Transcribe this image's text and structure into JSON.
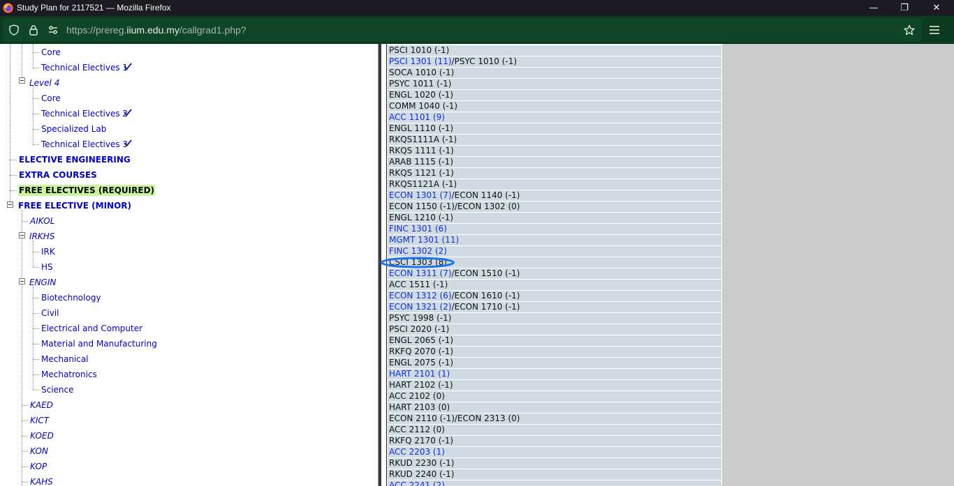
{
  "window": {
    "title": "Study Plan for 2117521 — Mozilla Firefox",
    "controls": [
      "—",
      "❐",
      "✕"
    ]
  },
  "toolbar": {
    "url_prefix": "https://prereg.",
    "url_host": "iium.edu.my",
    "url_path": "/callgrad1.php?"
  },
  "tree": [
    {
      "label": "Core",
      "style": "normal"
    },
    {
      "label": "Technical Electives 1",
      "style": "normal",
      "check": true
    },
    {
      "label": "Level 4",
      "style": "italic"
    },
    {
      "label": "Core",
      "style": "normal"
    },
    {
      "label": "Technical Electives 2",
      "style": "normal",
      "check": true
    },
    {
      "label": "Specialized Lab",
      "style": "normal"
    },
    {
      "label": "Technical Electives 3",
      "style": "normal",
      "check": true
    },
    {
      "label": "ELECTIVE ENGINEERING",
      "style": "bold"
    },
    {
      "label": "EXTRA COURSES",
      "style": "bold"
    },
    {
      "label": "FREE ELECTIVES (REQUIRED)",
      "style": "bold-highlight"
    },
    {
      "label": "FREE ELECTIVE (MINOR)",
      "style": "bold"
    },
    {
      "label": "AIKOL",
      "style": "italic"
    },
    {
      "label": "IRKHS",
      "style": "italic"
    },
    {
      "label": "IRK",
      "style": "normal"
    },
    {
      "label": "HS",
      "style": "normal"
    },
    {
      "label": "ENGIN",
      "style": "italic"
    },
    {
      "label": "Biotechnology",
      "style": "normal"
    },
    {
      "label": "Civil",
      "style": "normal"
    },
    {
      "label": "Electrical and Computer",
      "style": "normal"
    },
    {
      "label": "Material and Manufacturing",
      "style": "normal"
    },
    {
      "label": "Mechanical",
      "style": "normal"
    },
    {
      "label": "Mechatronics",
      "style": "normal"
    },
    {
      "label": "Science",
      "style": "normal"
    },
    {
      "label": "KAED",
      "style": "italic"
    },
    {
      "label": "KICT",
      "style": "italic"
    },
    {
      "label": "KOED",
      "style": "italic"
    },
    {
      "label": "KON",
      "style": "italic"
    },
    {
      "label": "KOP",
      "style": "italic"
    },
    {
      "label": "KAHS",
      "style": "italic"
    }
  ],
  "courses": [
    [
      {
        "t": "PSCI 1010 (-1)",
        "link": false
      }
    ],
    [
      {
        "t": "PSCI 1301 (11)",
        "link": true
      },
      {
        "t": "/PSYC 1010 (-1)",
        "link": false
      }
    ],
    [
      {
        "t": "SOCA 1010 (-1)",
        "link": false
      }
    ],
    [
      {
        "t": "PSYC 1011 (-1)",
        "link": false
      }
    ],
    [
      {
        "t": "ENGL 1020 (-1)",
        "link": false
      }
    ],
    [
      {
        "t": "COMM 1040 (-1)",
        "link": false
      }
    ],
    [
      {
        "t": "ACC 1101 (9)",
        "link": true
      }
    ],
    [
      {
        "t": "ENGL 1110 (-1)",
        "link": false
      }
    ],
    [
      {
        "t": "RKQS1111A (-1)",
        "link": false
      }
    ],
    [
      {
        "t": "RKQS 1111 (-1)",
        "link": false
      }
    ],
    [
      {
        "t": "ARAB 1115 (-1)",
        "link": false
      }
    ],
    [
      {
        "t": "RKQS 1121 (-1)",
        "link": false
      }
    ],
    [
      {
        "t": "RKQS1121A (-1)",
        "link": false
      }
    ],
    [
      {
        "t": "ECON 1301 (7)",
        "link": true
      },
      {
        "t": "/ECON 1140 (-1)",
        "link": false
      }
    ],
    [
      {
        "t": "ECON 1150 (-1)/ECON 1302 (0)",
        "link": false
      }
    ],
    [
      {
        "t": "ENGL 1210 (-1)",
        "link": false
      }
    ],
    [
      {
        "t": "FINC 1301 (6)",
        "link": true
      }
    ],
    [
      {
        "t": "MGMT 1301 (11)",
        "link": true
      }
    ],
    [
      {
        "t": "FINC 1302 (2)",
        "link": true
      }
    ],
    [
      {
        "t": "CSCI 1303 (8)",
        "link": false
      }
    ],
    [
      {
        "t": "ECON 1311 (7)",
        "link": true
      },
      {
        "t": "/ECON 1510 (-1)",
        "link": false
      }
    ],
    [
      {
        "t": "ACC 1511 (-1)",
        "link": false
      }
    ],
    [
      {
        "t": "ECON 1312 (6)",
        "link": true
      },
      {
        "t": "/ECON 1610 (-1)",
        "link": false
      }
    ],
    [
      {
        "t": "ECON 1321 (2)",
        "link": true
      },
      {
        "t": "/ECON 1710 (-1)",
        "link": false
      }
    ],
    [
      {
        "t": "PSYC 1998 (-1)",
        "link": false
      }
    ],
    [
      {
        "t": "PSCI 2020 (-1)",
        "link": false
      }
    ],
    [
      {
        "t": "ENGL 2065 (-1)",
        "link": false
      }
    ],
    [
      {
        "t": "RKFQ 2070 (-1)",
        "link": false
      }
    ],
    [
      {
        "t": "ENGL 2075 (-1)",
        "link": false
      }
    ],
    [
      {
        "t": "HART 2101 (1)",
        "link": true
      }
    ],
    [
      {
        "t": "HART 2102 (-1)",
        "link": false
      }
    ],
    [
      {
        "t": "ACC 2102 (0)",
        "link": false
      }
    ],
    [
      {
        "t": "HART 2103 (0)",
        "link": false
      }
    ],
    [
      {
        "t": "ECON 2110 (-1)/ECON 2313 (0)",
        "link": false
      }
    ],
    [
      {
        "t": "ACC 2112 (0)",
        "link": false
      }
    ],
    [
      {
        "t": "RKFQ 2170 (-1)",
        "link": false
      }
    ],
    [
      {
        "t": "ACC 2203 (1)",
        "link": true
      }
    ],
    [
      {
        "t": "RKUD 2230 (-1)",
        "link": false
      }
    ],
    [
      {
        "t": "RKUD 2240 (-1)",
        "link": false
      }
    ],
    [
      {
        "t": "ACC 2241 (2)",
        "link": true
      }
    ]
  ],
  "colors": {
    "titlebar": "#1c1b22",
    "toolbar": "#0b3a1e",
    "urlbar": "#0f4726",
    "link": "#0f2fe3",
    "tree_link": "#0000c8",
    "row_bg": "#cfdbe0",
    "highlight": "#c8f59a",
    "annotation_circle": "#1a73e8"
  }
}
